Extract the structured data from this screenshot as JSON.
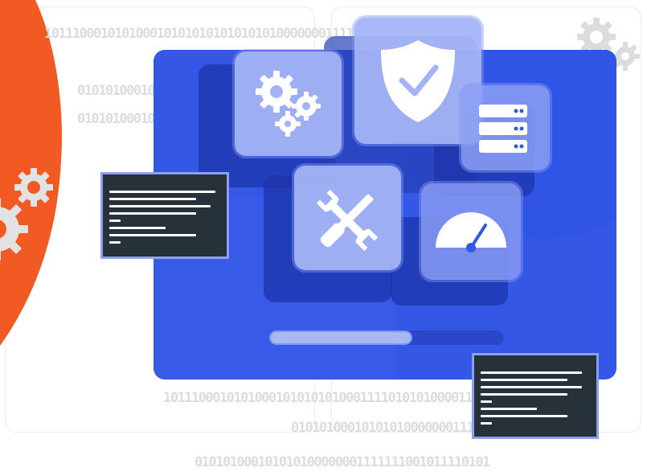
{
  "colors": {
    "accent_orange": "#f15a22",
    "monitor_blue": "#3457e6",
    "tile_light": "#a4b4f6",
    "terminal_bg": "#27313a",
    "gear_gray": "#dcdcdc"
  },
  "binary_strings": {
    "top": "10111000101010001010101010101010100000001111",
    "left_1": "010101000101",
    "left_2": "010101000101",
    "bottom_1": "1011100010101000101010101000111101010100001111",
    "bottom_2": "01010100010101010000000111",
    "bottom_3": "010101000101010100000001111111001011110101"
  },
  "icons": {
    "gears": "gears-icon",
    "shield": "shield-check-icon",
    "server": "server-icon",
    "tools": "wrench-screwdriver-icon",
    "gauge": "speedometer-icon",
    "deco_gears": "gear-icon"
  },
  "progress": {
    "value": 0.61
  }
}
